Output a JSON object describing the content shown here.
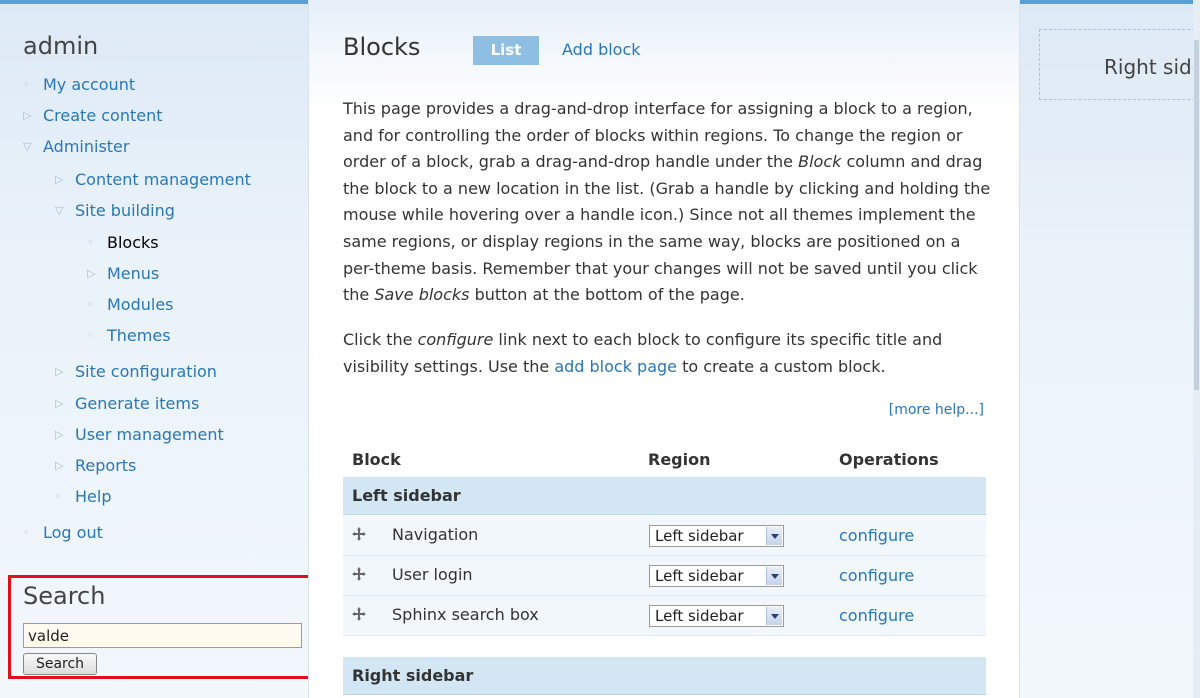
{
  "sidebar": {
    "title": "admin",
    "menu": {
      "my_account": "My account",
      "create_content": "Create content",
      "administer": "Administer",
      "content_management": "Content management",
      "site_building": "Site building",
      "blocks": "Blocks",
      "menus": "Menus",
      "modules": "Modules",
      "themes": "Themes",
      "site_configuration": "Site configuration",
      "generate_items": "Generate items",
      "user_management": "User management",
      "reports": "Reports",
      "help": "Help",
      "log_out": "Log out"
    }
  },
  "search": {
    "title": "Search",
    "value": "valde",
    "button_label": "Search"
  },
  "main": {
    "title": "Blocks",
    "tabs": {
      "list": "List",
      "add_block": "Add block"
    },
    "para1": {
      "p1": "This page provides a drag-and-drop interface for assigning a block to a region, and for controlling the order of blocks within regions. To change the region or order of a block, grab a drag-and-drop handle under the ",
      "em1": "Block",
      "p2": " column and drag the block to a new location in the list. (Grab a handle by clicking and holding the mouse while hovering over a handle icon.) Since not all themes implement the same regions, or display regions in the same way, blocks are positioned on a per-theme basis. Remember that your changes will not be saved until you click the ",
      "em2": "Save blocks",
      "p3": " button at the bottom of the page."
    },
    "para2": {
      "p1": "Click the ",
      "em1": "configure",
      "p2": " link next to each block to configure its specific title and visibility settings. Use the ",
      "link": "add block page",
      "p3": " to create a custom block."
    },
    "more_help": "[more help...]",
    "table": {
      "headers": {
        "block": "Block",
        "region": "Region",
        "operations": "Operations"
      },
      "regions": {
        "left": "Left sidebar",
        "right": "Right sidebar"
      },
      "rows": [
        {
          "name": "Navigation",
          "region": "Left sidebar",
          "op": "configure"
        },
        {
          "name": "User login",
          "region": "Left sidebar",
          "op": "configure"
        },
        {
          "name": "Sphinx search box",
          "region": "Left sidebar",
          "op": "configure"
        }
      ]
    }
  },
  "right": {
    "region_label": "Right sidebar"
  },
  "colors": {
    "link": "#2a76b8",
    "tab_active": "#8ebfe3",
    "highlight": "#e0101a"
  }
}
